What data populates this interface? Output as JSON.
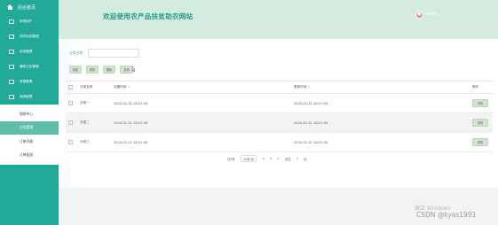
{
  "sidebar": {
    "title": "后台首页",
    "items": [
      {
        "label": "系统用户"
      },
      {
        "label": "扶贫动态管理"
      },
      {
        "label": "系统管理"
      },
      {
        "label": "通知公告管理"
      },
      {
        "label": "资源管理"
      },
      {
        "label": "商城管理"
      }
    ],
    "subitems": [
      {
        "label": "购物中心"
      },
      {
        "label": "分类管理"
      },
      {
        "label": "订单列表"
      },
      {
        "label": "订单配送"
      }
    ]
  },
  "header": {
    "welcome": "欢迎使用农产品扶贫助农网站",
    "username": "admin"
  },
  "search": {
    "label": "分类名称：",
    "value": "",
    "placeholder": ""
  },
  "toolbar": {
    "add": "添加",
    "edit": "修改",
    "delete": "删除",
    "query": "查询"
  },
  "table": {
    "headers": [
      "分类名称",
      "创建时间",
      "更新时间",
      "操作"
    ],
    "rows": [
      {
        "name": "分类一",
        "created": "2024-01-31 18:21:49",
        "updated": "2024-01-31 18:21:49",
        "action": "详情"
      },
      {
        "name": "分类二",
        "created": "2024-01-31 18:21:49",
        "updated": "2024-01-31 18:21:49",
        "action": "详情"
      },
      {
        "name": "分类三",
        "created": "2024-01-31 18:21:49",
        "updated": "2024-01-31 18:21:49",
        "action": "详情"
      }
    ]
  },
  "pagination": {
    "total": "共3条",
    "per_page": "10条/页",
    "prev": "<",
    "page": "1",
    "next": ">",
    "goto_label": "前往",
    "goto_value": "1",
    "page_suffix": "页"
  },
  "watermark": {
    "line1": "激活 Windows",
    "line2": "CSDN @kyas1991"
  }
}
